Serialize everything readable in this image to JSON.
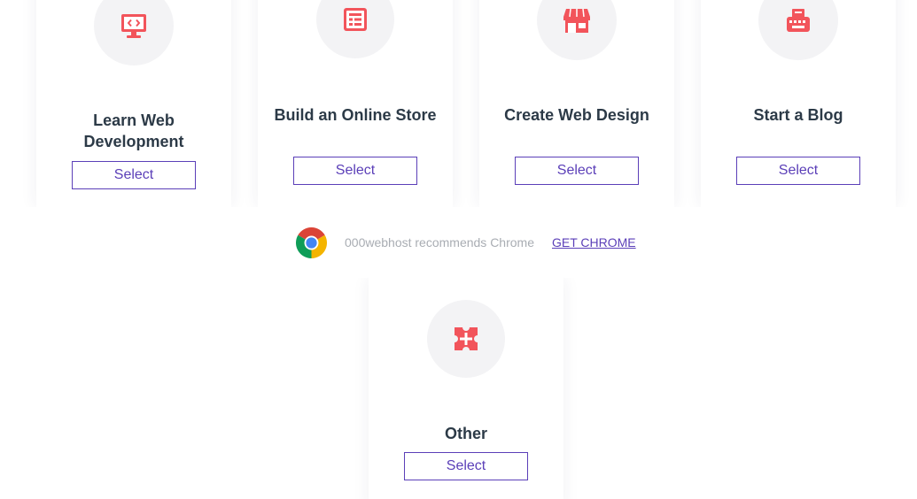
{
  "cards": [
    {
      "title": "Learn Web Development",
      "select_label": "Select",
      "icon": "monitor-code-icon"
    },
    {
      "title": "Build an Online Store",
      "select_label": "Select",
      "icon": "list-document-icon"
    },
    {
      "title": "Create Web Design",
      "select_label": "Select",
      "icon": "store-front-icon"
    },
    {
      "title": "Start a Blog",
      "select_label": "Select",
      "icon": "typewriter-icon"
    },
    {
      "title": "Other",
      "select_label": "Select",
      "icon": "puzzle-piece-icon"
    }
  ],
  "banner": {
    "message": "000webhost recommends Chrome",
    "link_label": "GET CHROME",
    "icon": "chrome-logo-icon"
  },
  "colors": {
    "icon_accent": "#f2545b",
    "button_accent": "#5b3fb8",
    "title_text": "#2c3a47",
    "banner_text": "#a9adb3",
    "icon_circle_bg": "#f3f3f5"
  }
}
